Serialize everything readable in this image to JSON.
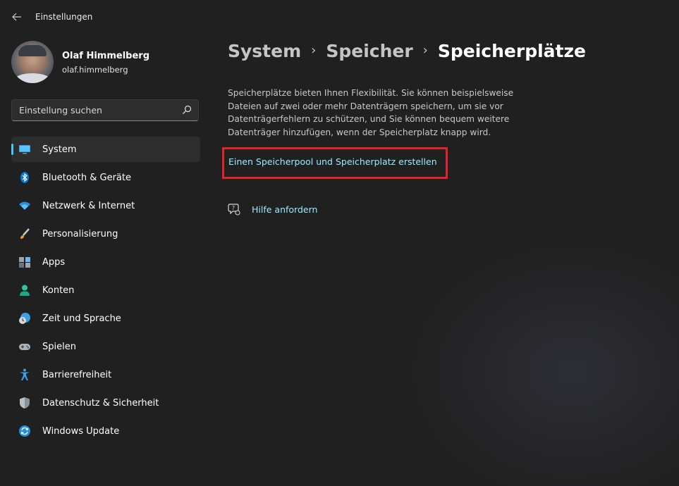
{
  "window": {
    "title": "Einstellungen",
    "back_icon": "arrow-left-icon"
  },
  "user": {
    "name": "Olaf Himmelberg",
    "email": "olaf.himmelberg"
  },
  "search": {
    "placeholder": "Einstellung suchen",
    "value": ""
  },
  "sidebar": {
    "items": [
      {
        "label": "System",
        "icon": "monitor-icon",
        "active": true
      },
      {
        "label": "Bluetooth & Geräte",
        "icon": "bluetooth-icon"
      },
      {
        "label": "Netzwerk & Internet",
        "icon": "wifi-icon"
      },
      {
        "label": "Personalisierung",
        "icon": "paintbrush-icon"
      },
      {
        "label": "Apps",
        "icon": "apps-icon"
      },
      {
        "label": "Konten",
        "icon": "person-icon"
      },
      {
        "label": "Zeit und Sprache",
        "icon": "clock-globe-icon"
      },
      {
        "label": "Spielen",
        "icon": "gamepad-icon"
      },
      {
        "label": "Barrierefreiheit",
        "icon": "accessibility-icon"
      },
      {
        "label": "Datenschutz & Sicherheit",
        "icon": "shield-icon"
      },
      {
        "label": "Windows Update",
        "icon": "update-icon"
      }
    ]
  },
  "breadcrumb": {
    "items": [
      "System",
      "Speicher",
      "Speicherplätze"
    ],
    "separator": "›"
  },
  "main": {
    "description": "Speicherplätze bieten Ihnen Flexibilität. Sie können beispielsweise Dateien auf zwei oder mehr Datenträgern speichern, um sie vor Datenträgerfehlern zu schützen, und Sie können bequem weitere Datenträger hinzufügen, wenn der Speicherplatz knapp wird.",
    "create_link": "Einen Speicherpool und Speicherplatz erstellen",
    "help_link": "Hilfe anfordern"
  },
  "colors": {
    "accent": "#4cc2ff",
    "link": "#99ebff",
    "highlight": "#e0242e",
    "background": "#202020"
  }
}
